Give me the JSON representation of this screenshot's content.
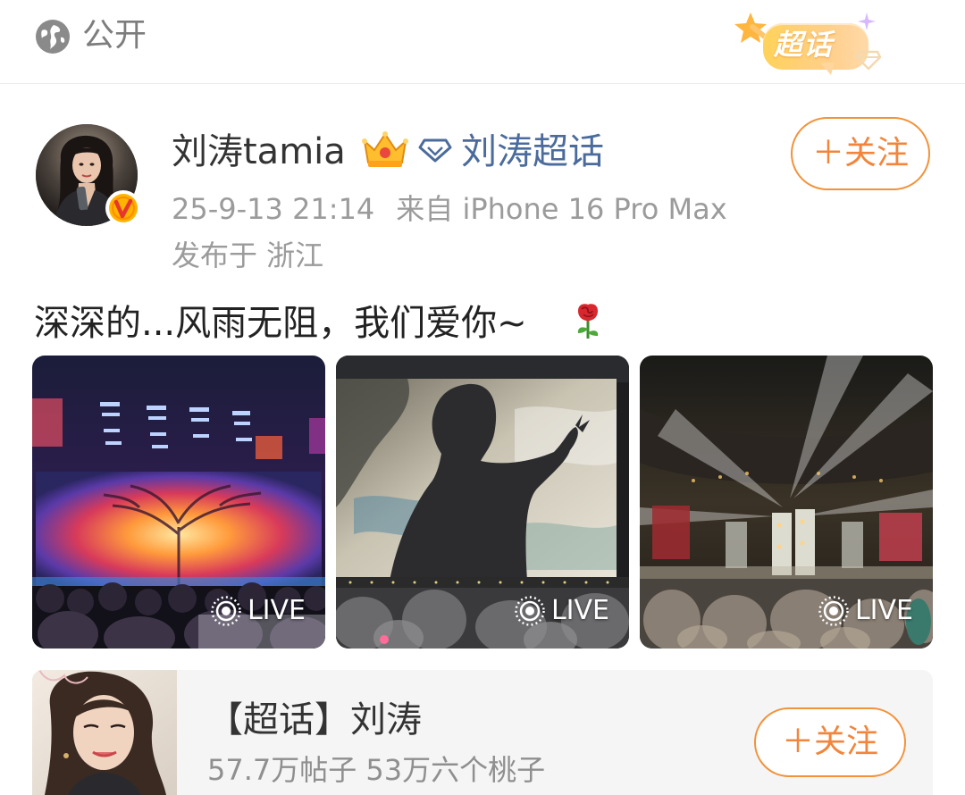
{
  "top_bar": {
    "visibility_icon": "globe-icon",
    "visibility_label": "公开",
    "badge_label": "超话"
  },
  "post": {
    "author": {
      "name": "刘涛tamia",
      "avatar": "avatar-photo",
      "verified_icon": "vip-v-badge-icon",
      "crown_icon": "crown-level-icon"
    },
    "supertopic_link": {
      "icon": "diamond-icon",
      "label": "刘涛超话"
    },
    "timestamp": "25-9-13 21:14",
    "source": "来自 iPhone 16 Pro Max",
    "location": "发布于 浙江",
    "follow_label": "＋关注",
    "text": "深深的...风雨无阻，我们爱你~",
    "text_emoji": "rose-icon",
    "photos": [
      {
        "live_label": "LIVE",
        "scene": "concert-stage-tree"
      },
      {
        "live_label": "LIVE",
        "scene": "concert-silhouette"
      },
      {
        "live_label": "LIVE",
        "scene": "concert-stadium-lights"
      }
    ]
  },
  "topic_card": {
    "title": "【超话】刘涛",
    "stats": "57.7万帖子 53万六个桃子",
    "follow_label": "＋关注"
  },
  "colors": {
    "accent_orange": "#f2853b",
    "link_blue": "#4a6b9c",
    "meta_gray": "#9b9b9b"
  }
}
